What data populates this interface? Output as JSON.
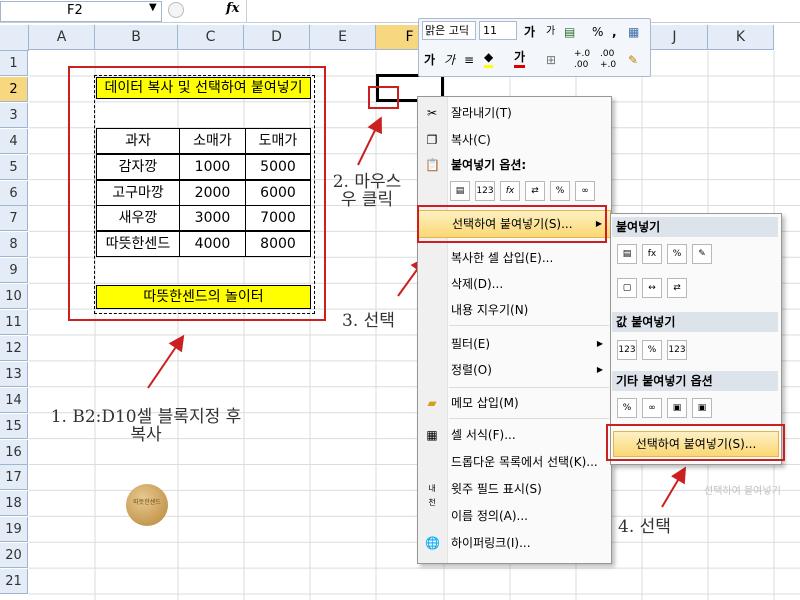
{
  "formula_bar": {
    "name_box": "F2",
    "fx": "fx"
  },
  "columns": [
    "A",
    "B",
    "C",
    "D",
    "E",
    "F",
    "G",
    "H",
    "I",
    "J",
    "K"
  ],
  "rows": [
    "1",
    "2",
    "3",
    "4",
    "5",
    "6",
    "7",
    "8",
    "9",
    "10",
    "11",
    "12",
    "13",
    "14",
    "15",
    "16",
    "17",
    "18",
    "19",
    "20",
    "21"
  ],
  "sheet": {
    "title": "데이터 복사 및 선택하여 붙여넣기",
    "headers": [
      "과자",
      "소매가",
      "도매가"
    ],
    "table": [
      [
        "감자깡",
        "1000",
        "5000"
      ],
      [
        "고구마깡",
        "2000",
        "6000"
      ],
      [
        "새우깡",
        "3000",
        "7000"
      ],
      [
        "따뜻한센드",
        "4000",
        "8000"
      ]
    ],
    "footer": "따뜻한센드의 놀이터"
  },
  "mini_toolbar": {
    "font_name": "맑은 고딕",
    "font_size": "11",
    "grow": "가",
    "shrink": "가",
    "percent": "%",
    "comma": ",",
    "bold": "가",
    "italic": "가",
    "font_color": "가",
    "dec_inc": "+.0 .00",
    "dec_dec": ".00 +.0"
  },
  "context_menu": {
    "cut": "잘라내기(T)",
    "copy": "복사(C)",
    "paste_options_header": "붙여넣기 옵션:",
    "paste_special": "선택하여 붙여넣기(S)...",
    "insert_copied": "복사한 셀 삽입(E)...",
    "delete": "삭제(D)...",
    "clear": "내용 지우기(N)",
    "filter": "필터(E)",
    "sort": "정렬(O)",
    "insert_comment": "메모 삽입(M)",
    "format_cells": "셀 서식(F)...",
    "pick_list": "드롭다운 목록에서 선택(K)...",
    "phonetic": "윗주 필드 표시(S)",
    "define_name": "이름 정의(A)...",
    "hyperlink": "하이퍼링크(I)..."
  },
  "paste_icons": [
    "123",
    "fx"
  ],
  "submenu": {
    "paste_header": "붙여넣기",
    "values_header": "값 붙여넣기",
    "other_header": "기타 붙여넣기 옵션",
    "paste_special": "선택하여 붙여넣기(S)..."
  },
  "annotations": {
    "step1": "1. B2:D10셀 블록지정 후 복사",
    "step2": "2. 마우스 우 클릭",
    "step3": "3. 선택",
    "step4": "4. 선택",
    "ghost_tooltip": "선택하여 붙여넣기"
  },
  "colors": {
    "accent": "#cc2020",
    "highlight": "#ffff00",
    "menu_hover": "#fbd873"
  }
}
